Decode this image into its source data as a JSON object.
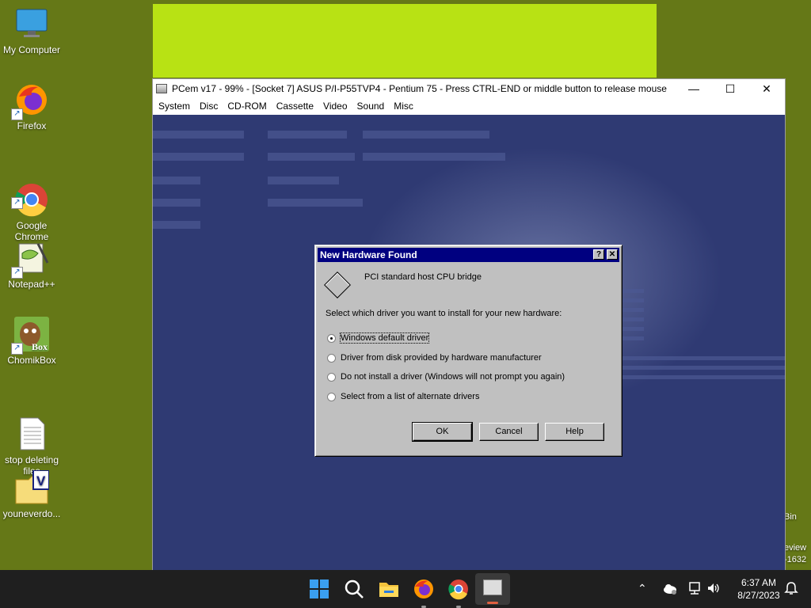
{
  "desktop": {
    "icons": [
      {
        "label": "My Computer",
        "icon": "monitor-icon"
      },
      {
        "label": "Firefox",
        "icon": "firefox-icon"
      },
      {
        "label": "Google\nChrome",
        "icon": "chrome-icon"
      },
      {
        "label": "Notepad++",
        "icon": "notepadpp-icon"
      },
      {
        "label": "ChomikBox",
        "icon": "chomikbox-icon"
      },
      {
        "label": "stop deleting\nfiles",
        "icon": "text-file-icon"
      },
      {
        "label": "youneverdo...",
        "icon": "vbs-file-icon"
      }
    ],
    "right_partial": [
      "Bin",
      "eview",
      "-1632"
    ]
  },
  "pcem": {
    "title": "PCem v17 - 99% - [Socket 7] ASUS P/I-P55TVP4 - Pentium 75 - Press CTRL-END or middle button to release mouse",
    "menu": [
      "System",
      "Disc",
      "CD-ROM",
      "Cassette",
      "Video",
      "Sound",
      "Misc"
    ]
  },
  "dialog": {
    "title": "New Hardware Found",
    "device": "PCI standard host CPU bridge",
    "prompt": "Select which driver you want to install for your new hardware:",
    "options": [
      {
        "label": "Windows default driver",
        "selected": true
      },
      {
        "label": "Driver from disk provided by hardware manufacturer",
        "selected": false
      },
      {
        "label": "Do not install a driver (Windows will not prompt you again)",
        "selected": false
      },
      {
        "label": "Select from a list of alternate drivers",
        "selected": false
      }
    ],
    "buttons": {
      "ok": "OK",
      "cancel": "Cancel",
      "help": "Help"
    }
  },
  "taskbar": {
    "time": "6:37 AM",
    "date": "8/27/2023"
  },
  "colors": {
    "desktop": "#657817",
    "accent": "#000080"
  }
}
